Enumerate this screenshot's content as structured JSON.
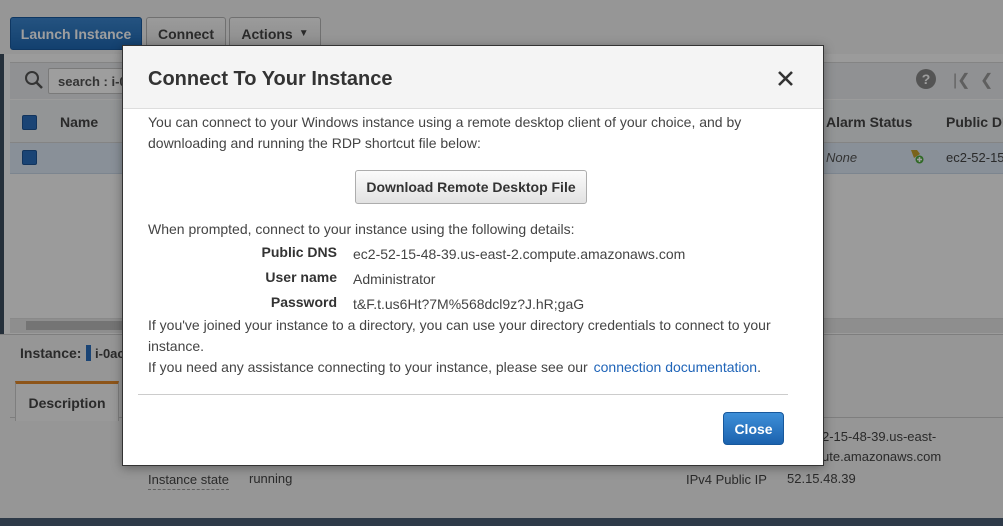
{
  "toolbar": {
    "launch_label": "Launch Instance",
    "connect_label": "Connect",
    "actions_label": "Actions"
  },
  "search": {
    "value": "search : i-0"
  },
  "table": {
    "headers": [
      "Name",
      "Alarm Status",
      "Public DN"
    ],
    "row": {
      "alarm_status": "None",
      "public_dns": "ec2-52-15"
    }
  },
  "details": {
    "instance_label": "Instance:",
    "instance_value": "i-0ac",
    "tab_description": "Description",
    "instance_state_label": "Instance state",
    "instance_state_value": "running",
    "public_dns_partial_line1": "2-15-48-39.us-east-",
    "public_dns_partial_line2": "ute.amazonaws.com",
    "ipv4_label": "IPv4 Public IP",
    "ipv4_value": "52.15.48.39"
  },
  "modal": {
    "title": "Connect To Your Instance",
    "intro_line1": "You can connect to your Windows instance using a remote desktop client of your choice, and by",
    "intro_line2": "downloading and running the RDP shortcut file below:",
    "download_button": "Download Remote Desktop File",
    "prompt_text": "When prompted, connect to your instance using the following details:",
    "fields": {
      "public_dns_label": "Public DNS",
      "public_dns_value": "ec2-52-15-48-39.us-east-2.compute.amazonaws.com",
      "username_label": "User name",
      "username_value": "Administrator",
      "password_label": "Password",
      "password_value": "t&F.t.us6Ht?7M%568dcl9z?J.hR;gaG"
    },
    "directory_line1": "If you've joined your instance to a directory, you can use your directory credentials to connect to your",
    "directory_line2": "instance.",
    "help_prefix": "If you need any assistance connecting to your instance, please see our",
    "help_link": "connection documentation",
    "help_suffix": ".",
    "close_button": "Close"
  },
  "colors": {
    "primary": "#1f68b3",
    "link": "#1f64b8",
    "tab_accent": "#e48a2a"
  },
  "icons": [
    "search-icon",
    "help-icon",
    "first-page-icon",
    "prev-page-icon",
    "close-icon",
    "chevron-down-icon",
    "alarm-add-icon"
  ]
}
